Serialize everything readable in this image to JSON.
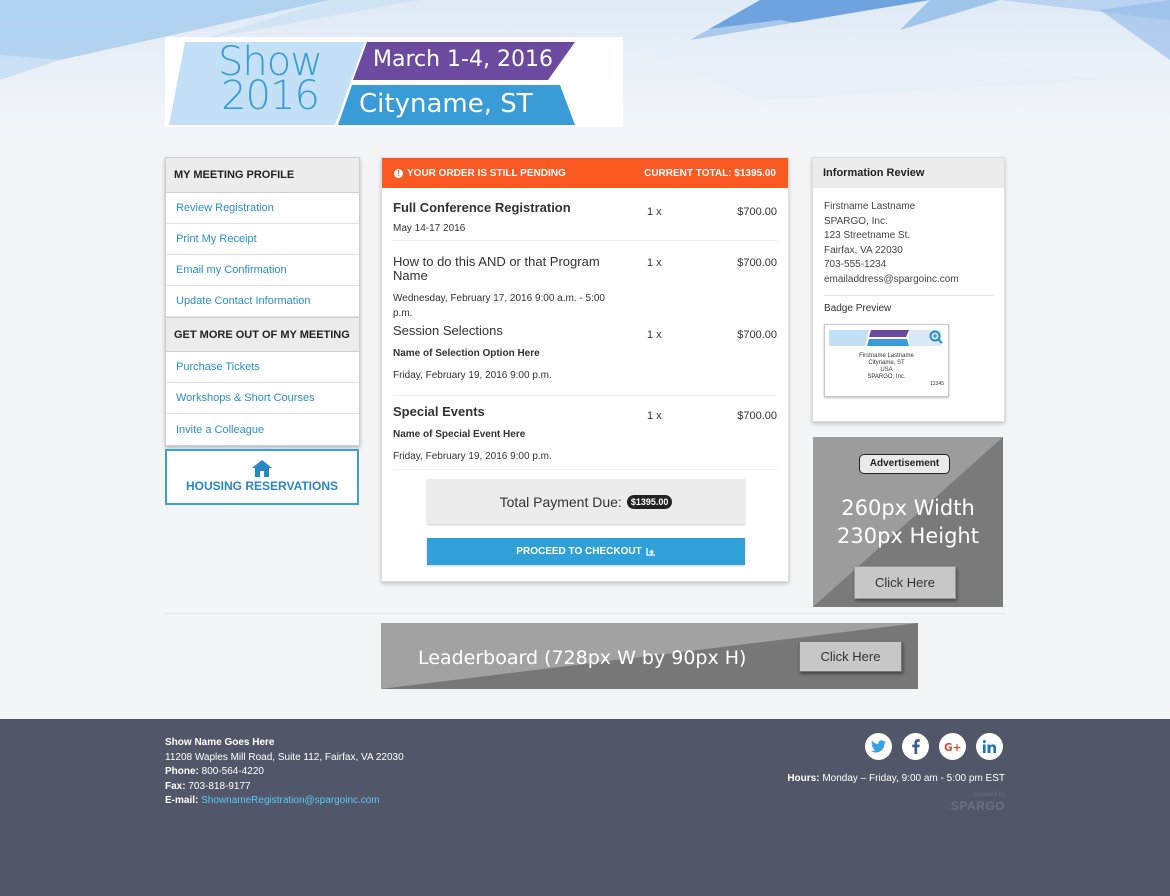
{
  "logo": {
    "show_line1": "Show",
    "show_line2": "2016",
    "dates": "March 1-4, 2016",
    "city": "Cityname, ST"
  },
  "sidebar": {
    "profile_heading": "MY MEETING PROFILE",
    "profile_items": [
      {
        "label": "Review Registration"
      },
      {
        "label": "Print My Receipt"
      },
      {
        "label": "Email my Confirmation"
      },
      {
        "label": "Update Contact Information"
      }
    ],
    "more_heading": "GET MORE OUT OF MY MEETING",
    "more_items": [
      {
        "label": "Purchase Tickets"
      },
      {
        "label": "Workshops & Short Courses"
      },
      {
        "label": "Invite a Colleague"
      }
    ],
    "housing_label": "HOUSING RESERVATIONS",
    "housing_icon": "home-icon"
  },
  "order": {
    "status": "YOUR ORDER IS STILL PENDING",
    "current_total": "CURRENT TOTAL: $1395.00",
    "items": [
      {
        "title": "Full Conference Registration",
        "sub": "May 14-17 2016",
        "qty": "1 x",
        "price": "$700.00"
      },
      {
        "title": "How to do this AND or that Program Name",
        "sub": "Wednesday, February 17, 2016 9:00 a.m. - 5:00 p.m.",
        "qty": "1 x",
        "price": "$700.00"
      },
      {
        "title": "Session Selections",
        "sub_bold": "Name of Selection Option Here",
        "sub": "Friday, February 19, 2016 9:00 p.m.",
        "qty": "1 x",
        "price": "$700.00"
      },
      {
        "title": "Special Events",
        "sub_bold": "Name of Special Event Here",
        "sub": "Friday, February 19, 2016 9:00 p.m.",
        "qty": "1 x",
        "price": "$700.00"
      }
    ],
    "total_label": "Total Payment Due:",
    "total_value": "$1395.00",
    "checkout_label": "PROCEED TO CHECKOUT"
  },
  "info_review": {
    "heading": "Information Review",
    "name": "Firstname Lastname",
    "company": "SPARGO, Inc.",
    "street": "123 Streetname St.",
    "city_line": "Fairfax, VA 22030",
    "phone": "703-555-1234",
    "email": "emailaddress@spargoinc.com",
    "badge_label": "Badge Preview",
    "badge": {
      "name": "Firstname Lastname",
      "city": "Cityname, ST",
      "country": "USA",
      "company": "SPARGO, Inc.",
      "number": "12345"
    }
  },
  "ad": {
    "tag": "Advertisement",
    "line1": "260px Width",
    "line2": "230px Height",
    "button": "Click Here"
  },
  "leaderboard": {
    "text": "Leaderboard (728px W by 90px H)",
    "button": "Click Here"
  },
  "footer": {
    "show_name": "Show Name Goes Here",
    "address": "11208 Waples Mill Road, Suite 112, Fairfax, VA 22030",
    "phone_label": "Phone:",
    "phone": "800-564-4220",
    "fax_label": "Fax:",
    "fax": "703-818-9177",
    "email_label": "E-mail:",
    "email": "ShownameRegistration@spargoinc.com",
    "hours_label": "Hours:",
    "hours": "Monday – Friday, 9:00 am - 5:00 pm EST",
    "powered_by": "powered by",
    "brand": "SPARGO",
    "socials": [
      "twitter-icon",
      "facebook-icon",
      "google-plus-icon",
      "linkedin-icon"
    ]
  },
  "colors": {
    "accent_orange": "#fa5a22",
    "accent_blue": "#2fa0d8",
    "logo_purple": "#6b4aa0",
    "logo_blue": "#3a9cd6",
    "footer_bg": "#515768"
  }
}
